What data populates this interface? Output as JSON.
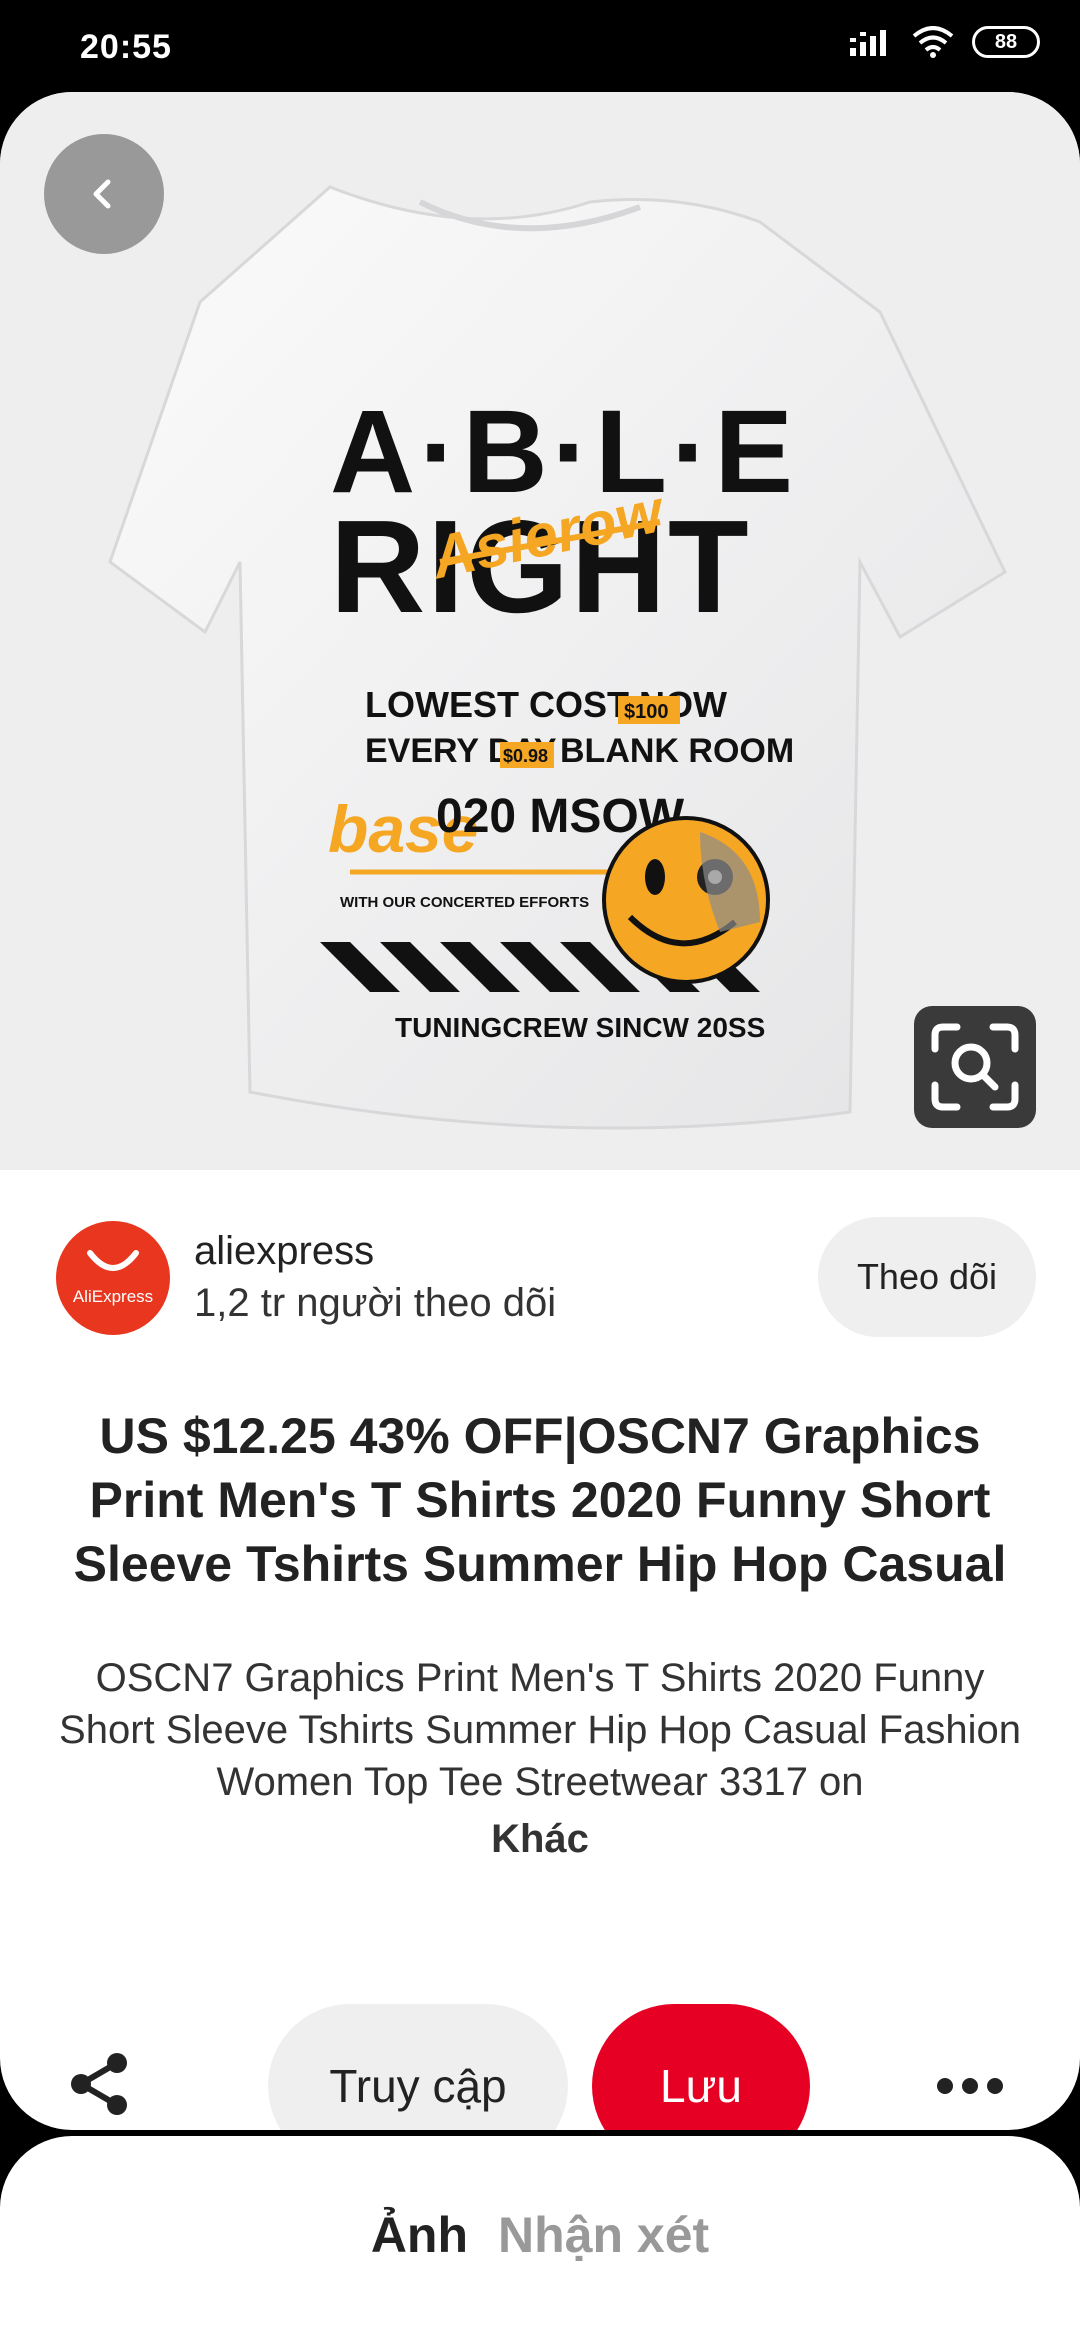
{
  "status_bar": {
    "time": "20:55",
    "battery": "88"
  },
  "hero": {
    "image_description": "White T-shirt with ABLE RIGHT graphic print",
    "print": {
      "line1": "A·B·L·E",
      "line2": "RIGHT",
      "script": "Asierow",
      "line3": "LOWEST COST NOW",
      "tag1": "$100",
      "line4a": "EVERY DAY",
      "tag2": "$0.98",
      "line4b": "BLANK ROOM",
      "script2": "base",
      "line5": "020 MSOW",
      "line6": "WITH OUR CONCERTED EFFORTS",
      "line7": "TUNINGCREW SINCW 20SS"
    }
  },
  "creator": {
    "name": "aliexpress",
    "logo_text": "AliExpress",
    "followers": "1,2 tr người theo dõi",
    "follow_label": "Theo dõi"
  },
  "pin": {
    "title": "US $12.25 43% OFF|OSCN7 Graphics Print Men's T Shirts 2020 Funny Short Sleeve Tshirts Summer Hip Hop Casual",
    "description": "OSCN7 Graphics Print Men's T Shirts 2020 Funny Short Sleeve Tshirts Summer Hip Hop Casual Fashion Women Top Tee Streetwear 3317 on",
    "more_label": "Khác"
  },
  "actions": {
    "visit_label": "Truy cập",
    "save_label": "Lưu"
  },
  "tabs": {
    "photo": "Ảnh",
    "comments": "Nhận xét"
  },
  "colors": {
    "save_red": "#e60023",
    "aliexpress_red": "#e8361f",
    "print_orange": "#f5a623"
  }
}
